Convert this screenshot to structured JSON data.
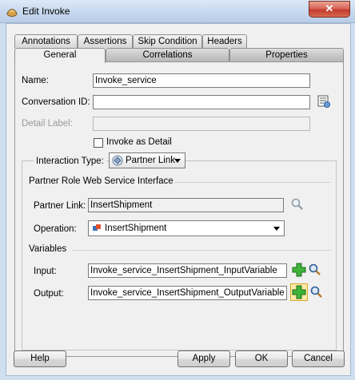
{
  "window": {
    "title": "Edit Invoke",
    "close_label": "✕"
  },
  "tabs_row1": [
    {
      "label": "Annotations"
    },
    {
      "label": "Assertions"
    },
    {
      "label": "Skip Condition"
    },
    {
      "label": "Headers"
    }
  ],
  "tabs_row2": [
    {
      "label": "General",
      "active": true
    },
    {
      "label": "Correlations"
    },
    {
      "label": "Properties"
    }
  ],
  "general": {
    "name_label": "Name:",
    "name_value": "Invoke_service",
    "conversation_id_label": "Conversation ID:",
    "conversation_id_value": "",
    "detail_label_label": "Detail Label:",
    "detail_label_value": "",
    "invoke_as_detail_label": "Invoke as Detail",
    "invoke_as_detail_checked": false,
    "interaction_type_label": "Interaction Type:",
    "interaction_type_value": "Partner Link"
  },
  "partner_role": {
    "section_label": "Partner Role Web Service Interface",
    "partner_link_label": "Partner Link:",
    "partner_link_value": "InsertShipment",
    "operation_label": "Operation:",
    "operation_value": "InsertShipment"
  },
  "variables": {
    "section_label": "Variables",
    "input_label": "Input:",
    "input_value": "Invoke_service_InsertShipment_InputVariable",
    "output_label": "Output:",
    "output_value": "Invoke_service_InsertShipment_OutputVariable"
  },
  "buttons": {
    "help": "Help",
    "apply": "Apply",
    "ok": "OK",
    "cancel": "Cancel"
  },
  "colors": {
    "titlebar": "#c6d8ee",
    "close": "#c23a2c",
    "add_icon": "#2fa52f",
    "dialog_bg": "#f0f0f0"
  }
}
